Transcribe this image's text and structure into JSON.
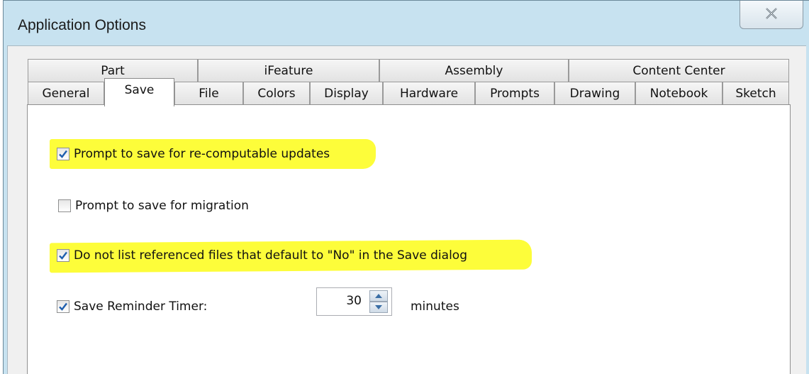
{
  "window": {
    "title": "Application Options"
  },
  "tabs_row1": [
    "Part",
    "iFeature",
    "Assembly",
    "Content Center"
  ],
  "tabs_row2": [
    "General",
    "Save",
    "File",
    "Colors",
    "Display",
    "Hardware",
    "Prompts",
    "Drawing",
    "Notebook",
    "Sketch"
  ],
  "active_tab": "Save",
  "options": {
    "recompute": {
      "label": "Prompt to save for re-computable updates",
      "checked": true
    },
    "migration": {
      "label": "Prompt to save for migration",
      "checked": false
    },
    "noref": {
      "label": "Do not list referenced files that default to \"No\" in the Save dialog",
      "checked": true
    },
    "timer": {
      "label": "Save Reminder Timer:",
      "checked": true,
      "value": "30",
      "unit": "minutes"
    }
  },
  "colors": {
    "highlight": "#fdfd3a",
    "check": "#1f5fae"
  }
}
